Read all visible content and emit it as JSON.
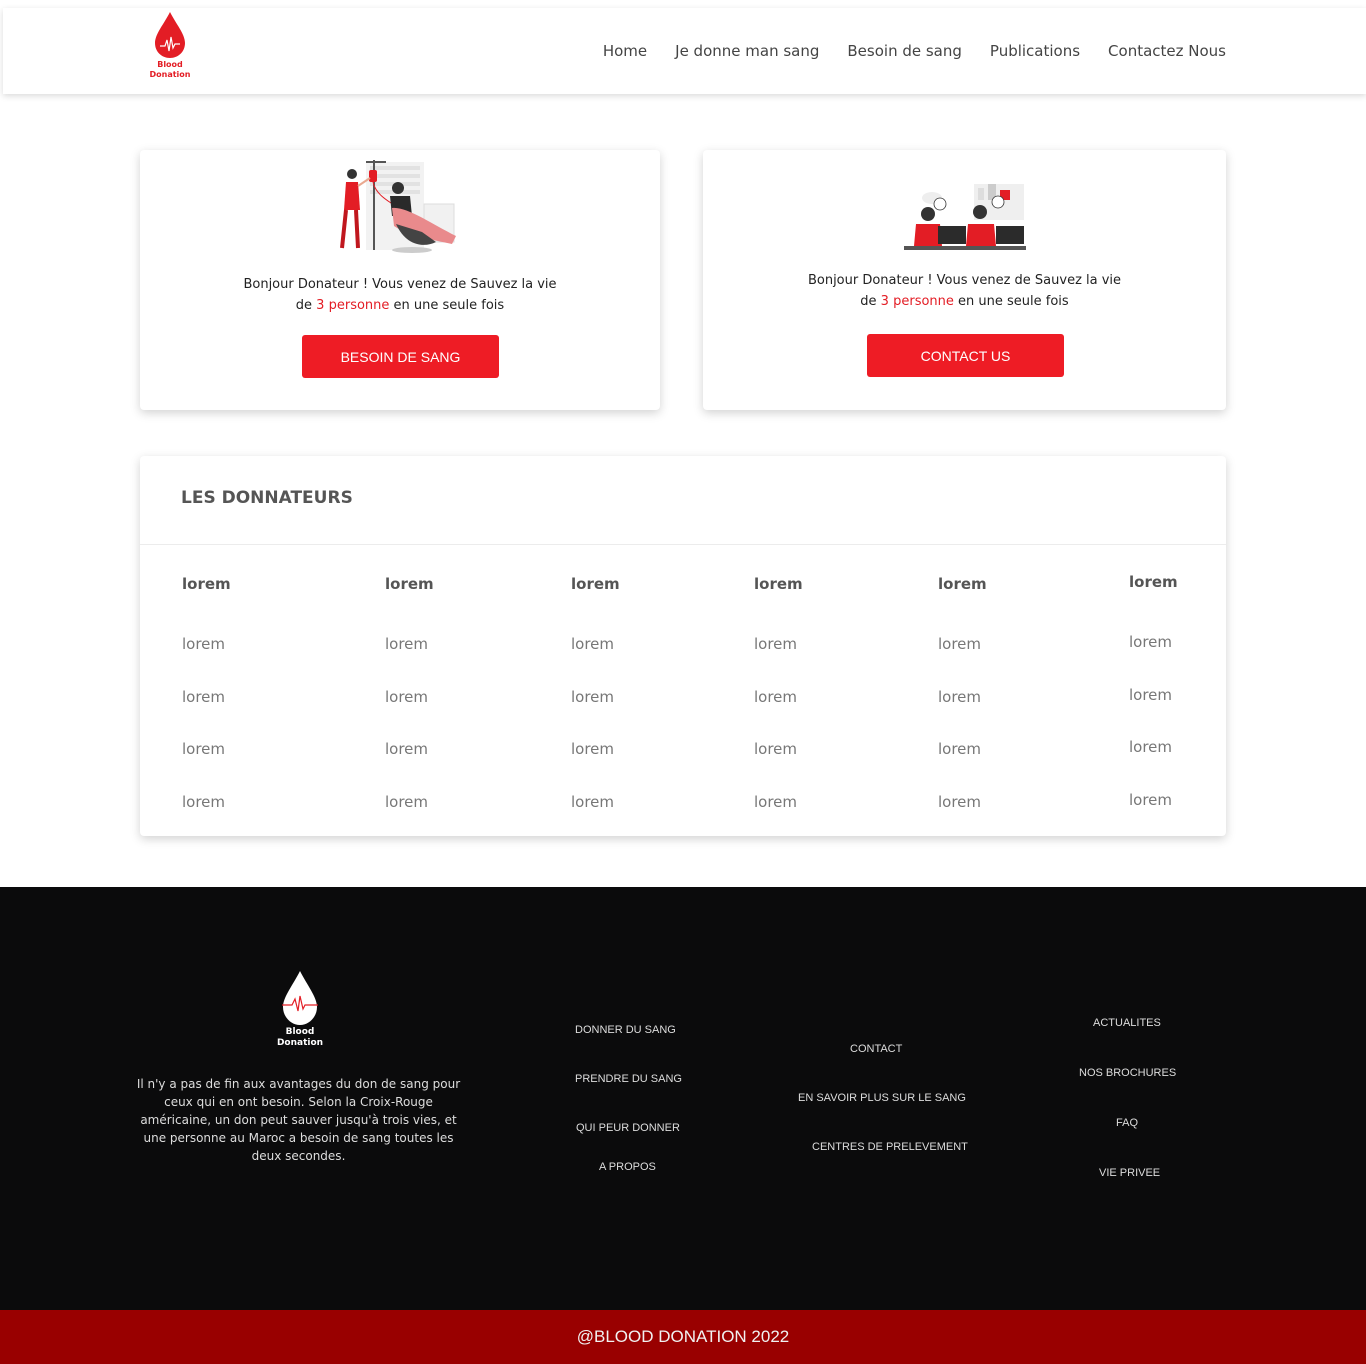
{
  "brand": {
    "logo_line1": "Blood",
    "logo_line2": "Donation",
    "red": "#e31d25"
  },
  "nav": {
    "items": [
      "Home",
      "Je donne man sang",
      "Besoin de sang",
      "Publications",
      "Contactez Nous"
    ]
  },
  "cards": [
    {
      "illustration": "blood-donation-illustration",
      "msg_line1": "Bonjour Donateur ! Vous venez de Sauvez la vie",
      "msg_de": "de",
      "count": "3",
      "persons": "personne",
      "msg_rest": "en une seule fois",
      "button": "BESOIN DE SANG"
    },
    {
      "illustration": "call-center-illustration",
      "msg_line1": "Bonjour Donateur ! Vous venez de Sauvez la vie",
      "msg_de": "de",
      "count": "3",
      "persons": "personne",
      "msg_rest": "en une seule fois",
      "button": "CONTACT US"
    }
  ],
  "donors": {
    "title": "LES DONNATEURS",
    "headers": [
      "lorem",
      "lorem",
      "lorem",
      "lorem",
      "lorem",
      "lorem"
    ],
    "rows": [
      [
        "lorem",
        "lorem",
        "lorem",
        "lorem",
        "lorem",
        "lorem"
      ],
      [
        "lorem",
        "lorem",
        "lorem",
        "lorem",
        "lorem",
        "lorem"
      ],
      [
        "lorem",
        "lorem",
        "lorem",
        "lorem",
        "lorem",
        "lorem"
      ],
      [
        "lorem",
        "lorem",
        "lorem",
        "lorem",
        "lorem",
        "lorem"
      ]
    ]
  },
  "footer": {
    "logo_line1": "Blood",
    "logo_line2": "Donation",
    "description": "Il n'y a pas de fin aux avantages du don de sang pour ceux qui en ont besoin. Selon la Croix-Rouge américaine, un don peut sauver jusqu'à trois vies, et une personne au Maroc a besoin de sang toutes les deux secondes.",
    "col1": [
      "DONNER DU SANG",
      "PRENDRE DU SANG",
      "QUI PEUR DONNER",
      "A PROPOS"
    ],
    "col2": [
      "CONTACT",
      "EN SAVOIR PLUS SUR LE SANG",
      "CENTRES DE PRELEVEMENT"
    ],
    "col3": [
      "ACTUALITES",
      "NOS BROCHURES",
      "FAQ",
      "VIE PRIVEE"
    ],
    "copyright": "@BLOOD DONATION 2022"
  }
}
